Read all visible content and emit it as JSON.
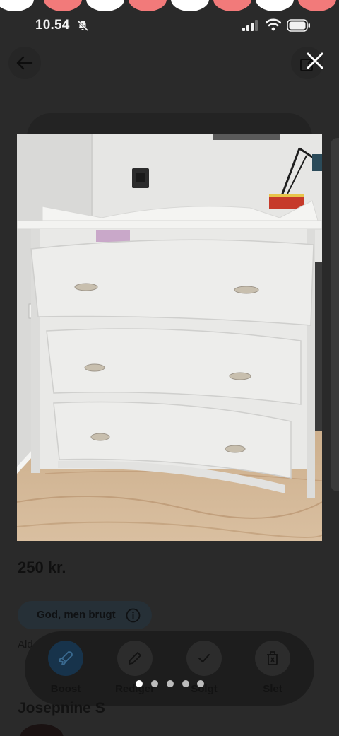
{
  "status_bar": {
    "time": "10.54",
    "icons": [
      "bell-muted-icon",
      "cellular-signal-icon",
      "wifi-icon",
      "battery-icon"
    ]
  },
  "top_bar": {
    "back_icon": "arrow-left-icon",
    "share_icon": "share-icon",
    "close_icon": "close-icon"
  },
  "gallery": {
    "image_subject": "white changing-table dresser with three drawers",
    "page_count": 5,
    "current_page": 1
  },
  "listing": {
    "price": "250 kr.",
    "condition": "God, men brugt",
    "age_prefix": "Ald"
  },
  "actions": [
    {
      "key": "boost",
      "label": "Boost",
      "icon": "rocket-icon"
    },
    {
      "key": "edit",
      "label": "Rediger",
      "icon": "pencil-icon"
    },
    {
      "key": "sold",
      "label": "Solgt",
      "icon": "check-icon"
    },
    {
      "key": "delete",
      "label": "Slet",
      "icon": "trash-icon"
    }
  ],
  "seller": {
    "name": "Josepnine S"
  },
  "colors": {
    "overlay_bg": "#2a2a2a",
    "accent_blue": "#17334b",
    "bubble_white": "#ffffff",
    "bubble_pink": "#f27a7a"
  }
}
